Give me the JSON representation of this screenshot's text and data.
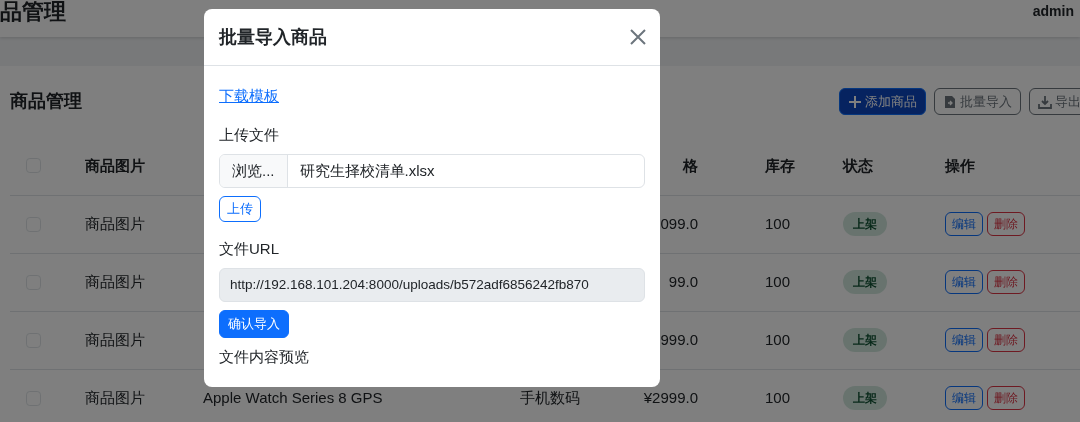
{
  "header": {
    "title": "品管理",
    "user": "admin"
  },
  "page": {
    "title": "商品管理",
    "buttons": [
      {
        "kind": "add",
        "label": "添加商品"
      },
      {
        "kind": "import",
        "label": "批量导入"
      },
      {
        "kind": "export",
        "label": "导出"
      }
    ]
  },
  "table": {
    "select_all": {
      "checked": false
    },
    "columns": {
      "image": "商品图片",
      "price": "格",
      "stock": "库存",
      "status": "状态",
      "actions": "操作"
    },
    "rows": [
      {
        "checked": false,
        "image": "商品图片",
        "price": "099.0",
        "stock": "100",
        "status": "上架",
        "actions": [
          "编辑",
          "删除"
        ]
      },
      {
        "checked": false,
        "image": "商品图片",
        "price": "99.0",
        "stock": "100",
        "status": "上架",
        "actions": [
          "编辑",
          "删除"
        ]
      },
      {
        "checked": false,
        "image": "商品图片",
        "price": "999.0",
        "stock": "100",
        "status": "上架",
        "actions": [
          "编辑",
          "删除"
        ]
      },
      {
        "checked": false,
        "image": "商品图片",
        "name": "Apple Watch Series 8 GPS",
        "category": "手机数码",
        "price": "¥2999.0",
        "stock": "100",
        "status": "上架",
        "actions": [
          "编辑",
          "删除"
        ]
      }
    ]
  },
  "modal": {
    "title": "批量导入商品",
    "link": "下载模板",
    "upload_label": "上传文件",
    "file_button": "浏览...",
    "file_name": "研究生择校清单.xlsx",
    "upload_button": "上传",
    "url_label": "文件URL",
    "url_value": "http://192.168.101.204:8000/uploads/b572adf6856242fb870",
    "confirm_button": "确认导入",
    "preview_label": "文件内容预览"
  }
}
